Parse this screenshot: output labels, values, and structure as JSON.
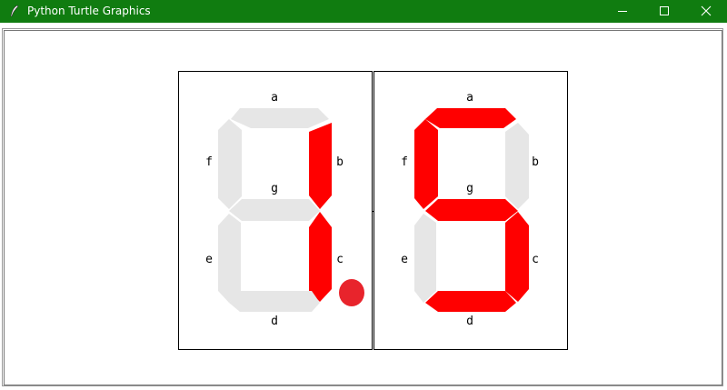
{
  "window": {
    "title": "Python Turtle Graphics",
    "icon": "feather-icon",
    "controls": [
      "minimize-icon",
      "maximize-icon",
      "close-icon"
    ]
  },
  "colors": {
    "titlebar": "#107c10",
    "segment_on": "#ff0000",
    "segment_off": "#e6e6e6",
    "decimal_point": "#e8242c"
  },
  "segment_labels": {
    "a": "a",
    "b": "b",
    "c": "c",
    "d": "d",
    "e": "e",
    "f": "f",
    "g": "g"
  },
  "digits": [
    {
      "segments_on": {
        "a": false,
        "b": true,
        "c": true,
        "d": false,
        "e": false,
        "f": false,
        "g": false
      },
      "decimal_point": true
    },
    {
      "segments_on": {
        "a": true,
        "b": false,
        "c": true,
        "d": true,
        "e": false,
        "f": true,
        "g": true
      },
      "decimal_point": false
    }
  ]
}
